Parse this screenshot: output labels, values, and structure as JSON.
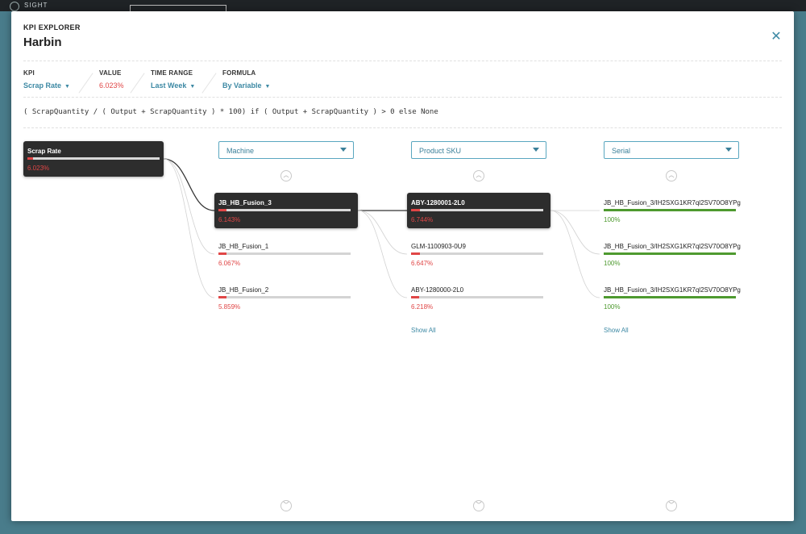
{
  "topbar": {
    "logo_text": "SIGHT"
  },
  "modal": {
    "eyebrow": "KPI EXPLORER",
    "title": "Harbin",
    "close_glyph": "✕",
    "fields": {
      "kpi": {
        "label": "KPI",
        "value": "Scrap Rate"
      },
      "value": {
        "label": "VALUE",
        "value": "6.023%"
      },
      "time_range": {
        "label": "TIME RANGE",
        "value": "Last Week"
      },
      "formula": {
        "label": "FORMULA",
        "value": "By Variable"
      }
    },
    "formula_text": "( ScrapQuantity / ( Output + ScrapQuantity ) * 100) if ( Output + ScrapQuantity ) > 0 else None",
    "root": {
      "name": "Scrap Rate",
      "pct": "6.023%",
      "fill": 0.04
    },
    "columns": [
      {
        "dropdown": "Machine",
        "nodes": [
          {
            "name": "JB_HB_Fusion_3",
            "pct": "6.143%",
            "fill": 0.06,
            "active": true
          },
          {
            "name": "JB_HB_Fusion_1",
            "pct": "6.067%",
            "fill": 0.06,
            "active": false
          },
          {
            "name": "JB_HB_Fusion_2",
            "pct": "5.859%",
            "fill": 0.06,
            "active": false
          }
        ],
        "show_all": ""
      },
      {
        "dropdown": "Product SKU",
        "nodes": [
          {
            "name": "ABY-1280001-2L0",
            "pct": "6.744%",
            "fill": 0.07,
            "active": true
          },
          {
            "name": "GLM-1100903-0U9",
            "pct": "6.647%",
            "fill": 0.07,
            "active": false
          },
          {
            "name": "ABY-1280000-2L0",
            "pct": "6.218%",
            "fill": 0.06,
            "active": false
          }
        ],
        "show_all": "Show All"
      },
      {
        "dropdown": "Serial",
        "nodes": [
          {
            "name": "JB_HB_Fusion_3/IH2SXG1KR7ql2SV70O8YPg",
            "pct": "100%",
            "fill": 1,
            "active": false
          },
          {
            "name": "JB_HB_Fusion_3/IH2SXG1KR7ql2SV70O8YPg",
            "pct": "100%",
            "fill": 1,
            "active": false
          },
          {
            "name": "JB_HB_Fusion_3/IH2SXG1KR7ql2SV70O8YPg",
            "pct": "100%",
            "fill": 1,
            "active": false
          }
        ],
        "show_all": "Show All"
      }
    ],
    "colors": {
      "accent": "#3d89a4",
      "danger": "#e04646",
      "success": "#4e9a2f",
      "active_node": "#2d2d2d"
    }
  }
}
